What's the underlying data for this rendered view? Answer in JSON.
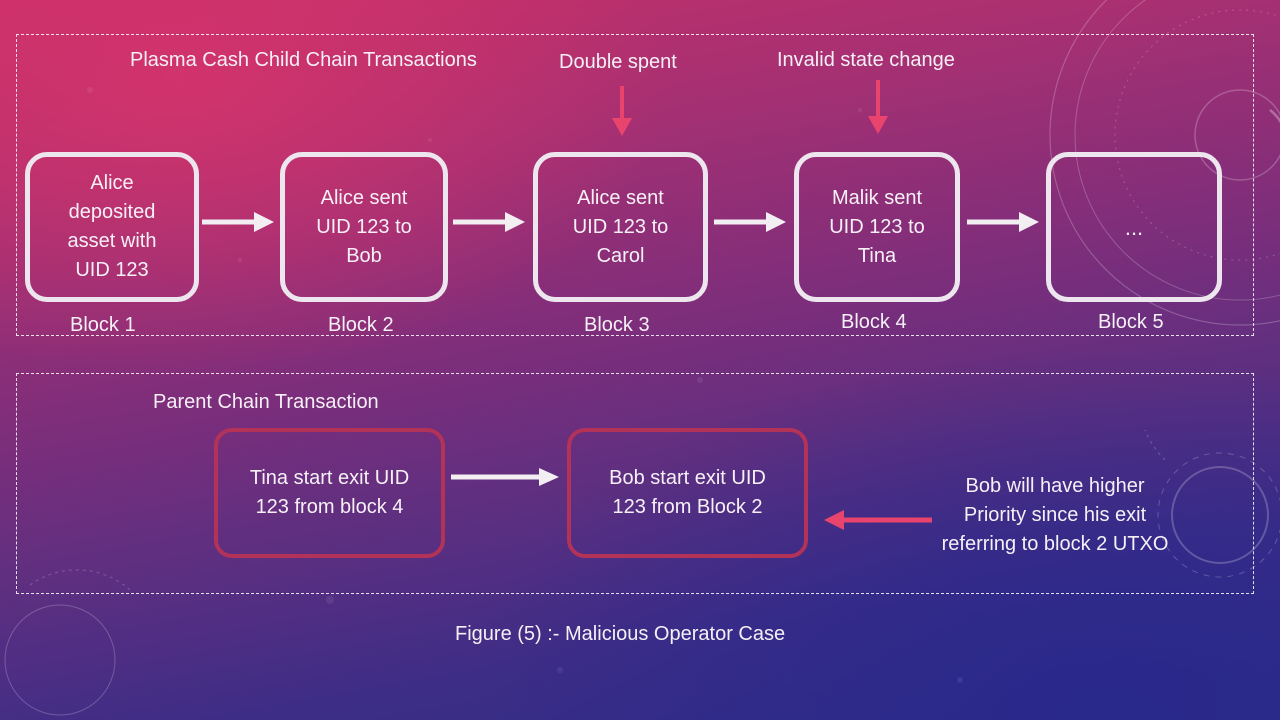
{
  "slide": {
    "caption": "Figure (5) :- Malicious Operator Case"
  },
  "child_chain": {
    "title": "Plasma Cash Child Chain Transactions",
    "annotations": [
      {
        "text": "Double spent",
        "target_block": 3
      },
      {
        "text": "Invalid state change",
        "target_block": 4
      }
    ],
    "blocks": [
      {
        "content": "Alice\ndeposited\nasset with\nUID 123",
        "label": "Block 1"
      },
      {
        "content": "Alice sent\nUID 123 to\nBob",
        "label": "Block 2"
      },
      {
        "content": "Alice sent\nUID 123 to\nCarol",
        "label": "Block 3"
      },
      {
        "content": "Malik sent\nUID 123 to\nTina",
        "label": "Block 4"
      },
      {
        "content": "...",
        "label": "Block 5"
      }
    ]
  },
  "parent_chain": {
    "title": "Parent Chain Transaction",
    "exits": [
      {
        "content": "Tina start exit UID\n123 from block 4"
      },
      {
        "content": "Bob start exit UID\n123 from Block 2"
      }
    ],
    "note": "Bob will have higher\nPriority since his exit\nreferring to block 2 UTXO"
  },
  "colors": {
    "block_border": "#ede6ee",
    "exit_border": "#b23258",
    "highlight_arrow": "#e8446e",
    "flow_arrow": "#f2eef2"
  }
}
